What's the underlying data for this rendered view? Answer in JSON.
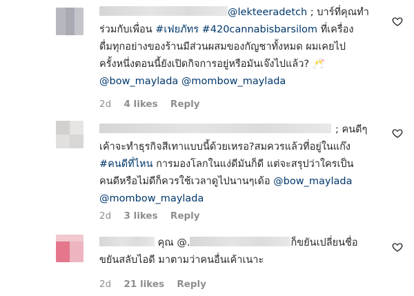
{
  "comments": [
    {
      "mention": "@lekteeradetch",
      "line1_tail": " ; บาร์ที่คุณทำ",
      "line2_plain": "ร่วมกับเพื่อน ",
      "hashtag1": "#เฟยภัทร",
      "hashtag2": "#420cannabisbarsilom",
      "line2_tail": " ที่เครื่อง",
      "line3": "ดื่มทุกอย่างของร้านมีส่วนผสมของกัญชาทั้งหมด ผมเคยไป",
      "line4": "ครั้งหนึ่งตอนนี้ยังเปิดกิจการอยู่หรือมันเจ๊งไปแล้ว? 🥂",
      "tag1": "@bow_maylada",
      "tag2": "@mombow_maylada",
      "time": "2d",
      "likes": "4 likes",
      "reply": "Reply"
    },
    {
      "line1_tail": "; คนดีๆ",
      "line2": "เค้าจะทำธุรกิจสีเทาแบบนี้ด้วยเหรอ?สมควรแล้วที่อยู่ในแก๊ง",
      "hashtag": "#คนดีที่ไหน",
      "line3_tail": " การมองโลกในแง่ดีมันก็ดี แต่จะสรุปว่าใครเป็น",
      "line4_plain": "คนดีหรือไม่ดีก็ควรใช้เวลาดูไปนานๆเด้อ ",
      "tag1": "@bow_maylada",
      "tag2": "@mombow_maylada",
      "time": "2d",
      "likes": "3 likes",
      "reply": "Reply"
    },
    {
      "line1_mid": " คุณ @.",
      "line1_tail": "ก็ขยันเปลี่ยนชื่อ",
      "line2": "ขยันสลับไอดี มาตามว่าคนอื่นเค้าเนาะ",
      "time": "2d",
      "likes": "21 likes",
      "reply": "Reply"
    }
  ],
  "colors": {
    "text": "#262626",
    "link": "#00376b",
    "meta": "#8e8e8e"
  },
  "icons": {
    "like": "heart-outline-icon"
  }
}
